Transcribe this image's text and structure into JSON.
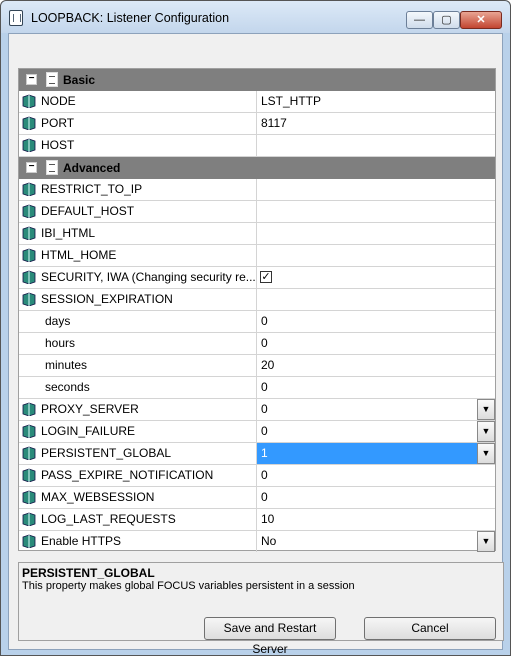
{
  "window": {
    "title": "LOOPBACK: Listener Configuration",
    "controls": {
      "minimize": "—",
      "maximize": "▢",
      "close": "✕"
    }
  },
  "categories": {
    "basic": {
      "label": "Basic",
      "toggle": "−"
    },
    "advanced": {
      "label": "Advanced",
      "toggle": "−"
    }
  },
  "properties": {
    "node": {
      "name": "NODE",
      "value": "LST_HTTP"
    },
    "port": {
      "name": "PORT",
      "value": "8117"
    },
    "host": {
      "name": "HOST",
      "value": ""
    },
    "restrict_to_ip": {
      "name": "RESTRICT_TO_IP",
      "value": ""
    },
    "default_host": {
      "name": "DEFAULT_HOST",
      "value": ""
    },
    "ibi_html": {
      "name": "IBI_HTML",
      "value": ""
    },
    "html_home": {
      "name": "HTML_HOME",
      "value": ""
    },
    "security": {
      "name": "SECURITY, IWA  (Changing security re...",
      "checked": true,
      "check_glyph": "✓"
    },
    "session_expiration": {
      "name": "SESSION_EXPIRATION",
      "value": ""
    },
    "days": {
      "name": "days",
      "value": "0"
    },
    "hours": {
      "name": "hours",
      "value": "0"
    },
    "minutes": {
      "name": "minutes",
      "value": "20"
    },
    "seconds": {
      "name": "seconds",
      "value": "0"
    },
    "proxy_server": {
      "name": "PROXY_SERVER",
      "value": "0"
    },
    "login_failure": {
      "name": "LOGIN_FAILURE",
      "value": "0"
    },
    "persistent_global": {
      "name": "PERSISTENT_GLOBAL",
      "value": "1"
    },
    "pass_expire_notification": {
      "name": "PASS_EXPIRE_NOTIFICATION",
      "value": "0"
    },
    "max_websession": {
      "name": "MAX_WEBSESSION",
      "value": "0"
    },
    "log_last_requests": {
      "name": "LOG_LAST_REQUESTS",
      "value": "10"
    },
    "enable_https": {
      "name": "Enable HTTPS",
      "value": "No"
    }
  },
  "dropdown_glyph": "▼",
  "description": {
    "title": "PERSISTENT_GLOBAL",
    "text": "This property makes global FOCUS variables persistent in a session"
  },
  "buttons": {
    "save": "Save and Restart Server",
    "cancel": "Cancel"
  },
  "colors": {
    "category_bg": "#7f7f7f",
    "selection": "#3399ff"
  }
}
